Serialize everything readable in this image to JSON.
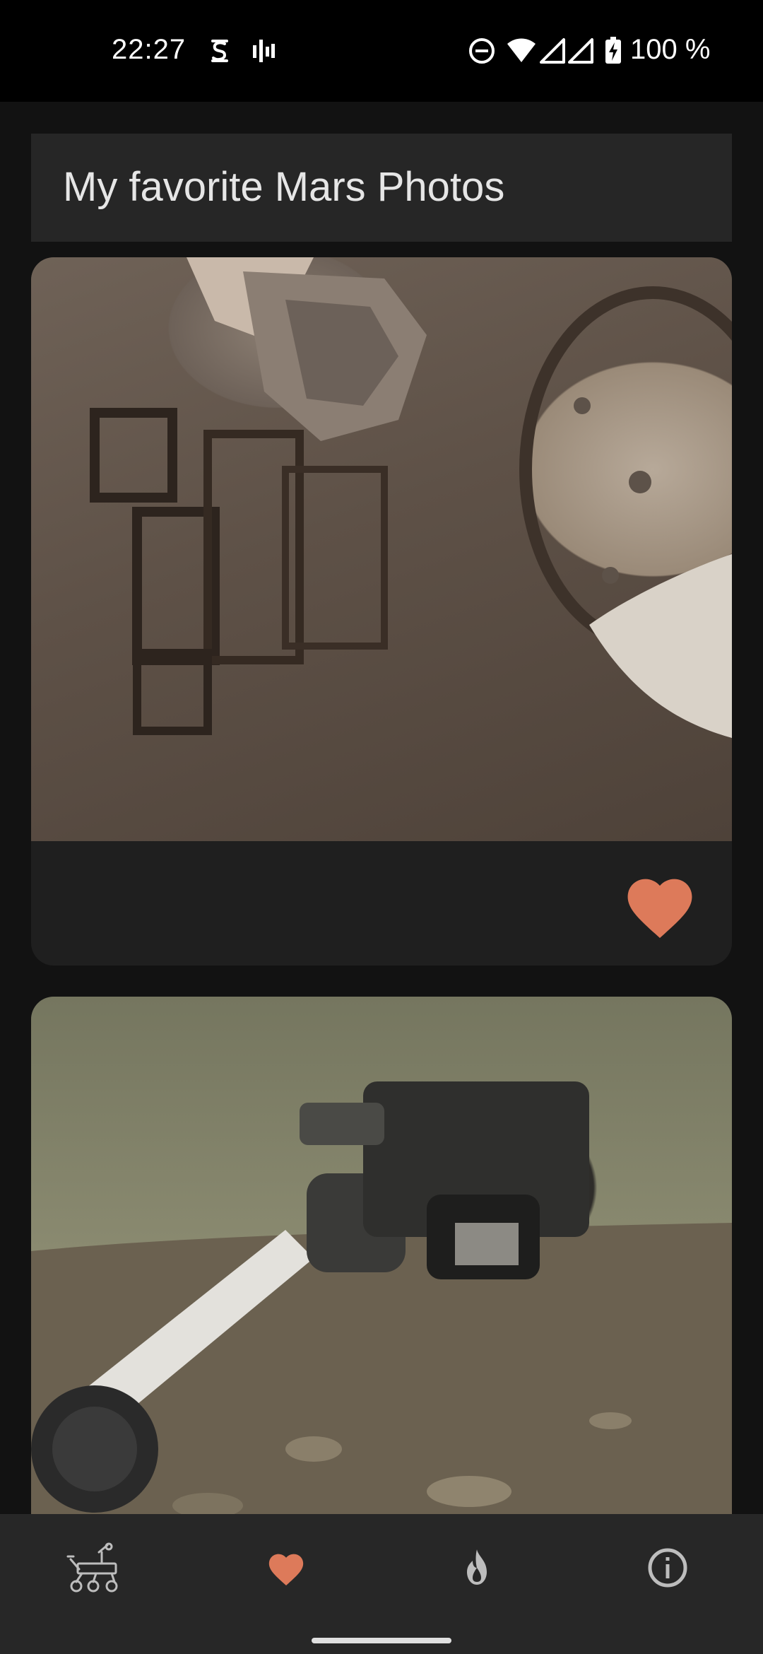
{
  "status_bar": {
    "time": "22:27",
    "battery": "100 %",
    "icons": [
      "s-icon",
      "signal-bars-icon",
      "do-not-disturb-icon",
      "wifi-icon",
      "cell-signal-icon",
      "cell-signal-icon",
      "battery-charging-icon"
    ]
  },
  "header": {
    "title": "My favorite Mars Photos"
  },
  "photos": [
    {
      "icon": "favorite-heart-icon",
      "favorited": true
    },
    {
      "icon": "favorite-heart-icon"
    }
  ],
  "bottom_nav": {
    "items": [
      {
        "icon": "rover-icon"
      },
      {
        "icon": "heart-icon",
        "active": true
      },
      {
        "icon": "flame-icon"
      },
      {
        "icon": "info-icon"
      }
    ]
  },
  "colors": {
    "accent": "#dd7a5a",
    "background": "#121212",
    "surface": "#262626",
    "nav": "#272727",
    "icon_muted": "#bdbdbd"
  }
}
